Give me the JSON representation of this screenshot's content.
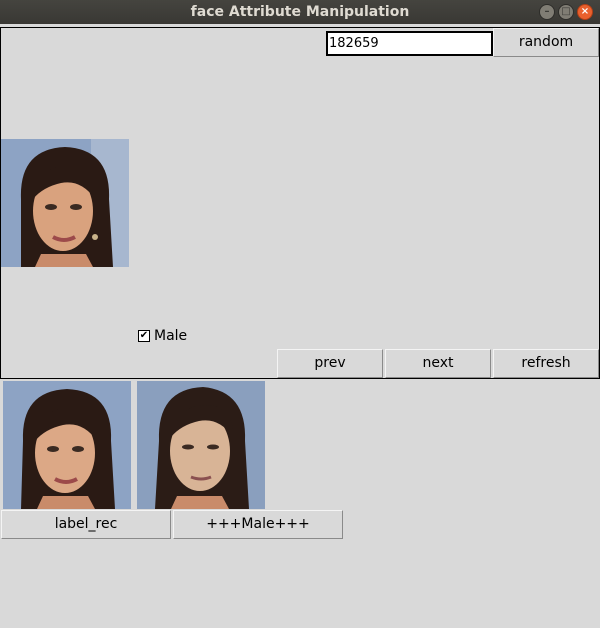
{
  "window": {
    "title": "face Attribute Manipulation",
    "minimize_glyph": "–",
    "maximize_glyph": "□",
    "close_glyph": "×"
  },
  "controls": {
    "seed_value": "182659",
    "random_label": "random",
    "prev_label": "prev",
    "next_label": "next",
    "refresh_label": "refresh"
  },
  "attributes": [
    {
      "label": "Male",
      "checked": true
    }
  ],
  "outputs": {
    "label_rec_label": "label_rec",
    "male_label": "+++Male+++"
  },
  "icons": {
    "minimize": "minimize-icon",
    "maximize": "maximize-icon",
    "close": "close-icon",
    "check": "checkmark-icon"
  }
}
